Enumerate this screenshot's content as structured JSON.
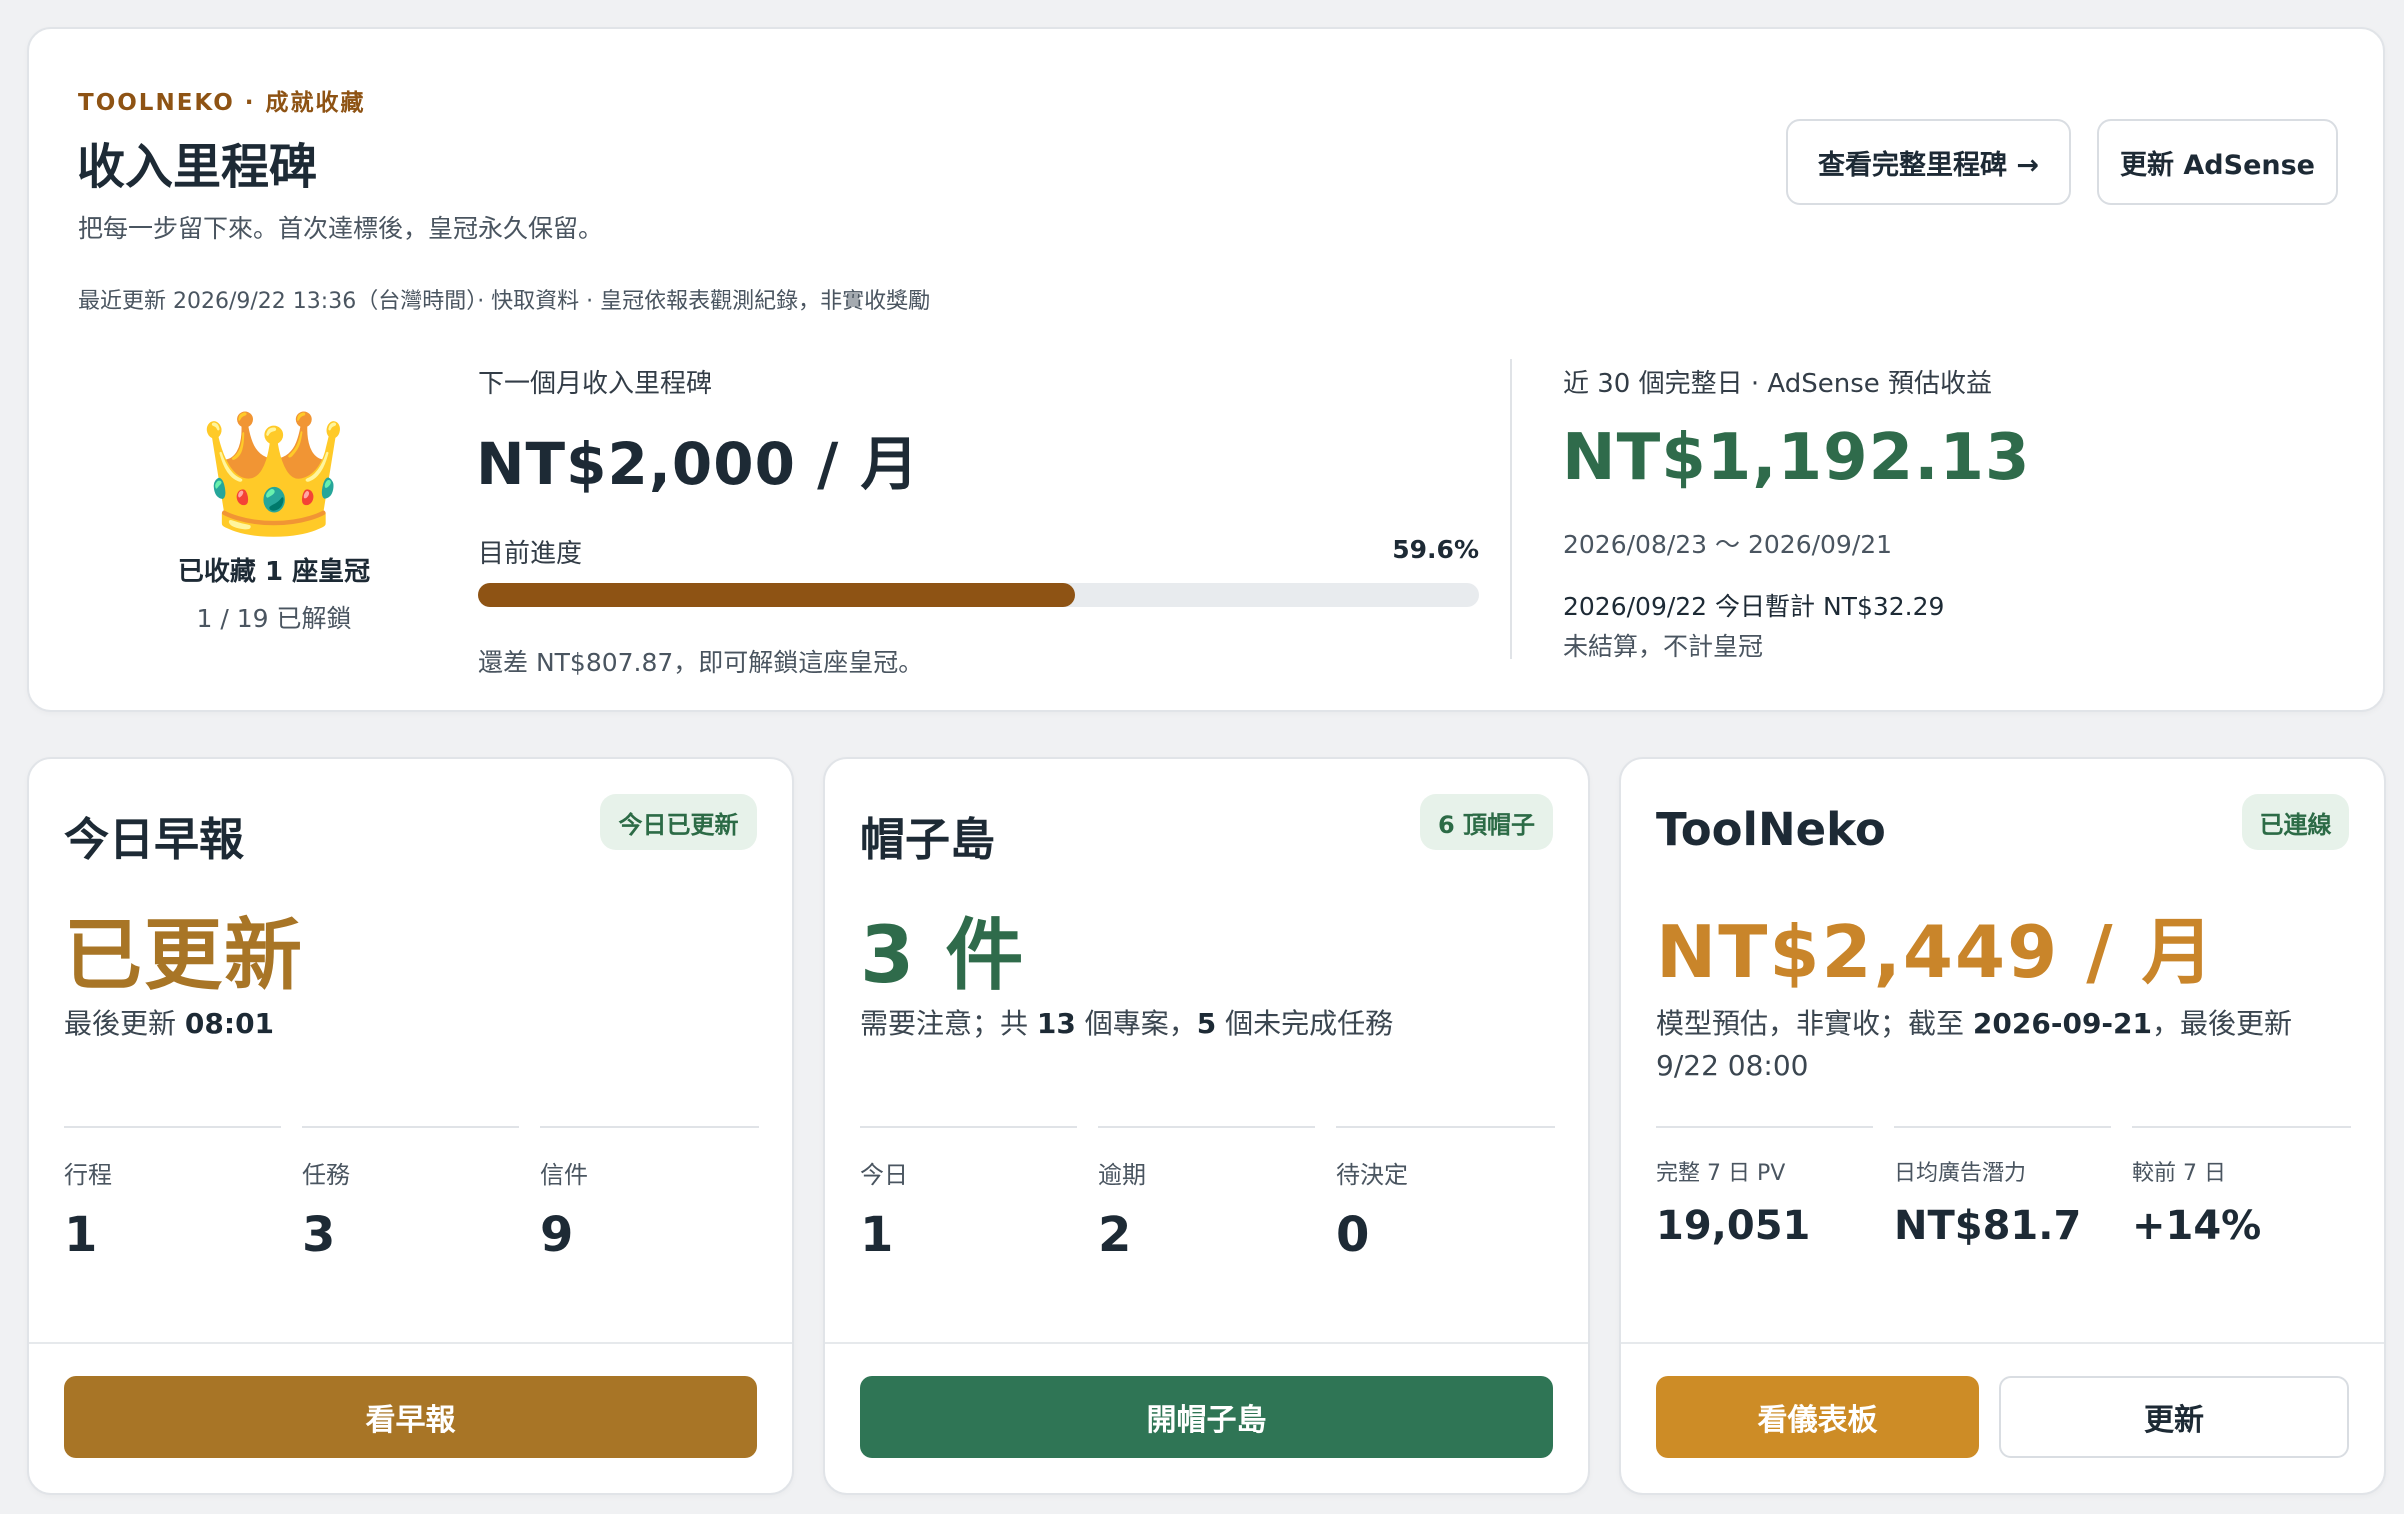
{
  "milestone": {
    "eyebrow_brand": "TOOLNEKO",
    "eyebrow_sep": " · ",
    "eyebrow_label": "成就收藏",
    "title": "收入里程碑",
    "subtitle": "把每一步留下來。首次達標後，皇冠永久保留。",
    "meta": "最近更新 2026/9/22 13:36（台灣時間）· 快取資料 · 皇冠依報表觀測紀錄，非實收獎勵",
    "buttons": {
      "view_full": "查看完整里程碑 →",
      "refresh_adsense": "更新 AdSense"
    },
    "crown": {
      "icon": "👑",
      "collected": "已收藏 1 座皇冠",
      "unlocked": "1 / 19 已解鎖"
    },
    "next": {
      "label": "下一個月收入里程碑",
      "target": "NT$2,000 / 月",
      "progress_label": "目前進度",
      "progress_text": "59.6%",
      "progress_value": 0.596,
      "remaining": "還差 NT$807.87，即可解鎖這座皇冠。"
    },
    "earnings": {
      "label": "近 30 個完整日 · AdSense 預估收益",
      "amount": "NT$1,192.13",
      "range": "2026/08/23 ～ 2026/09/21",
      "today": "2026/09/22 今日暫計 NT$32.29",
      "note": "未結算，不計皇冠"
    }
  },
  "cards": [
    {
      "title": "今日早報",
      "badge": "今日已更新",
      "big": "已更新",
      "desc_prefix": "最後更新 ",
      "desc_time": "08:01",
      "stats": [
        {
          "label": "行程",
          "value": "1"
        },
        {
          "label": "任務",
          "value": "3"
        },
        {
          "label": "信件",
          "value": "9"
        }
      ],
      "button": "看早報"
    },
    {
      "title": "帽子島",
      "badge": "6 頂帽子",
      "big": "3 件",
      "desc_a": "需要注意；共 ",
      "desc_b": "13",
      "desc_c": " 個專案，",
      "desc_d": "5",
      "desc_e": " 個未完成任務",
      "stats": [
        {
          "label": "今日",
          "value": "1"
        },
        {
          "label": "逾期",
          "value": "2"
        },
        {
          "label": "待決定",
          "value": "0"
        }
      ],
      "button": "開帽子島"
    },
    {
      "title": "ToolNeko",
      "badge": "已連線",
      "big": "NT$2,449 / 月",
      "desc_a": "模型預估，非實收；截至 ",
      "desc_b": "2026-09-21",
      "desc_c": "，最後更新 9/22 08:00",
      "stats": [
        {
          "label": "完整 7 日 PV",
          "value": "19,051"
        },
        {
          "label": "日均廣告潛力",
          "value": "NT$81.7"
        },
        {
          "label": "較前 7 日",
          "value": "+14%"
        }
      ],
      "button_primary": "看儀表板",
      "button_secondary": "更新"
    }
  ],
  "colors": {
    "brown_accent": "#8e5314",
    "gold": "#a87526",
    "green_accent": "#2f6b4b",
    "green_button": "#2f7555",
    "orange_accent": "#c9852a",
    "orange_button": "#cd8c26"
  }
}
